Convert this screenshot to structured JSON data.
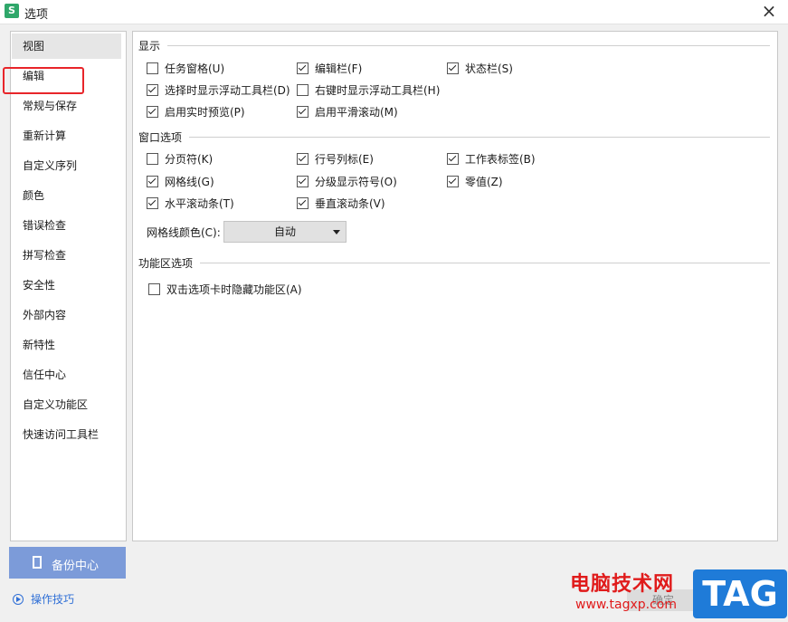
{
  "window": {
    "title": "选项",
    "app_icon_letter": "S",
    "close_label": "×"
  },
  "sidebar": {
    "items": [
      {
        "label": "视图",
        "active": true
      },
      {
        "label": "编辑",
        "active": false
      },
      {
        "label": "常规与保存",
        "active": false
      },
      {
        "label": "重新计算",
        "active": false
      },
      {
        "label": "自定义序列",
        "active": false
      },
      {
        "label": "颜色",
        "active": false
      },
      {
        "label": "错误检查",
        "active": false
      },
      {
        "label": "拼写检查",
        "active": false
      },
      {
        "label": "安全性",
        "active": false
      },
      {
        "label": "外部内容",
        "active": false
      },
      {
        "label": "新特性",
        "active": false
      },
      {
        "label": "信任中心",
        "active": false
      },
      {
        "label": "自定义功能区",
        "active": false
      },
      {
        "label": "快速访问工具栏",
        "active": false
      }
    ]
  },
  "display": {
    "title": "显示",
    "options": [
      {
        "label": "任务窗格(U)",
        "checked": false
      },
      {
        "label": "编辑栏(F)",
        "checked": true
      },
      {
        "label": "状态栏(S)",
        "checked": true
      },
      {
        "label": "选择时显示浮动工具栏(D)",
        "checked": true
      },
      {
        "label": "右键时显示浮动工具栏(H)",
        "checked": false
      },
      {
        "label": "启用实时预览(P)",
        "checked": true
      },
      {
        "label": "启用平滑滚动(M)",
        "checked": true
      }
    ]
  },
  "window_options": {
    "title": "窗口选项",
    "options": [
      {
        "label": "分页符(K)",
        "checked": false
      },
      {
        "label": "行号列标(E)",
        "checked": true
      },
      {
        "label": "工作表标签(B)",
        "checked": true
      },
      {
        "label": "网格线(G)",
        "checked": true
      },
      {
        "label": "分级显示符号(O)",
        "checked": true
      },
      {
        "label": "零值(Z)",
        "checked": true
      },
      {
        "label": "水平滚动条(T)",
        "checked": true
      },
      {
        "label": "垂直滚动条(V)",
        "checked": true
      }
    ],
    "grid_color_label": "网格线颜色(C):",
    "grid_color_value": "自动"
  },
  "ribbon": {
    "title": "功能区选项",
    "options": [
      {
        "label": "双击选项卡时隐藏功能区(A)",
        "checked": false
      }
    ]
  },
  "footer": {
    "backup_label": "备份中心",
    "tips_label": "操作技巧",
    "ok_label": "确定"
  },
  "watermark": {
    "text": "电脑技术网",
    "url": "www.tagxp.com",
    "tag": "TAG"
  },
  "colors": {
    "highlight": "#e8252a",
    "backup_button": "#7c9bd9",
    "link": "#2f6fd6",
    "app_icon": "#2fa76a"
  }
}
